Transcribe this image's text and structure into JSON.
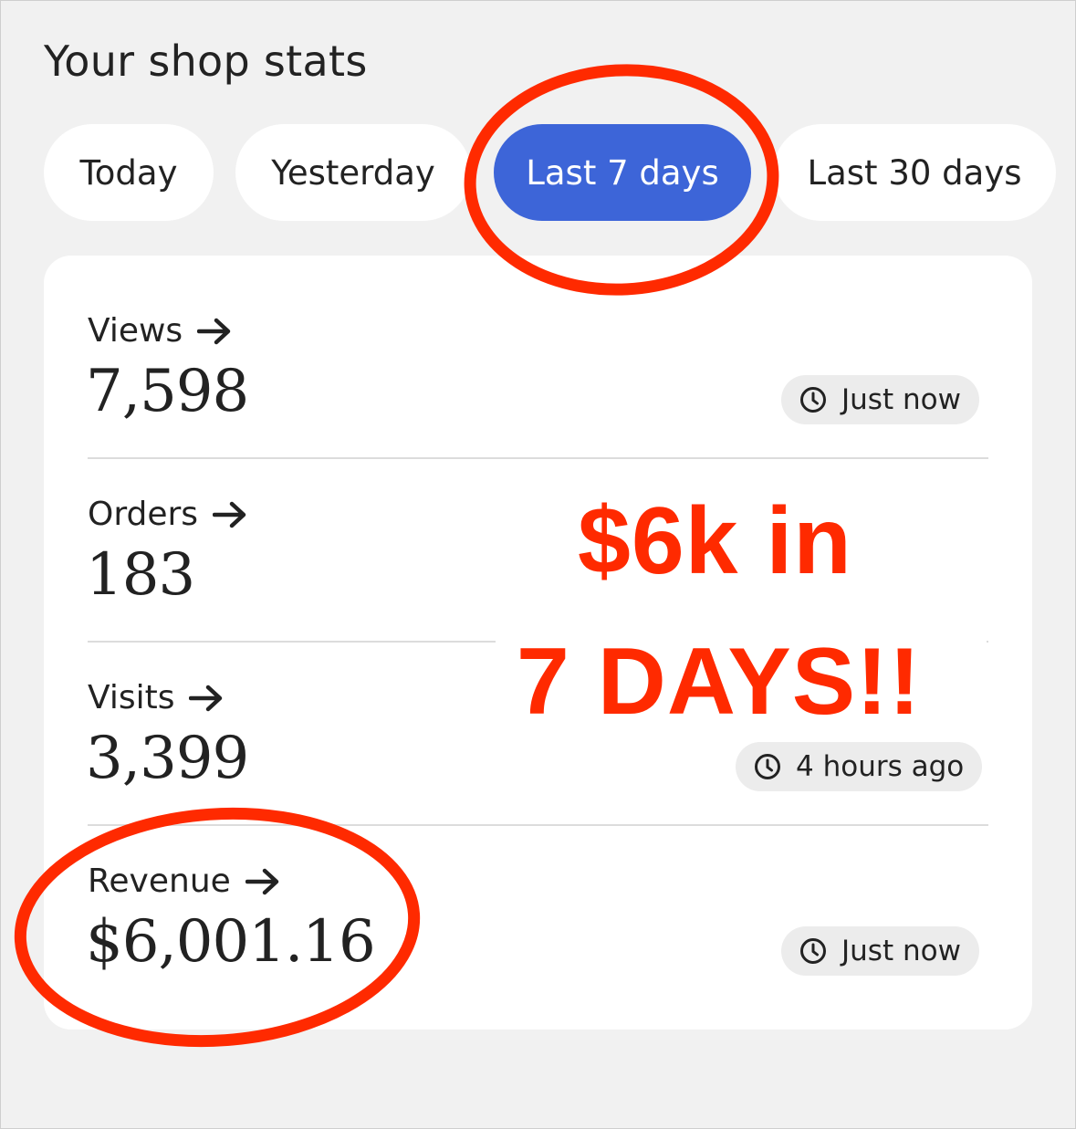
{
  "header": {
    "title": "Your shop stats"
  },
  "range_tabs": [
    {
      "label": "Today",
      "selected": false
    },
    {
      "label": "Yesterday",
      "selected": false
    },
    {
      "label": "Last 7 days",
      "selected": true
    },
    {
      "label": "Last 30 days",
      "selected": false
    }
  ],
  "stats": [
    {
      "label": "Views",
      "value": "7,598",
      "updated": "Just now"
    },
    {
      "label": "Orders",
      "value": "183",
      "updated": ""
    },
    {
      "label": "Visits",
      "value": "3,399",
      "updated": "4 hours ago"
    },
    {
      "label": "Revenue",
      "value": "$6,001.16",
      "updated": "Just now"
    }
  ],
  "overlay": {
    "line1": "$6k in",
    "line2": "7 DAYS!!",
    "color": "#ff2a00"
  },
  "colors": {
    "accent": "#3d65d8",
    "background": "#f1f1f1",
    "card": "#ffffff",
    "annotation": "#ff2a00"
  },
  "icons": {
    "stat_link": "arrow-right-icon",
    "updated": "clock-icon"
  }
}
